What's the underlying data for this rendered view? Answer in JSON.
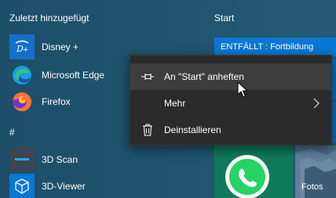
{
  "start_menu": {
    "recent_header": "Zuletzt hinzugefügt",
    "tiles_header": "Start",
    "apps": [
      {
        "label": "Disney +",
        "icon": "disney-plus-icon"
      },
      {
        "label": "Microsoft Edge",
        "icon": "edge-icon"
      },
      {
        "label": "Firefox",
        "icon": "firefox-icon"
      }
    ],
    "letter_header": "#",
    "letter_apps": [
      {
        "label": "3D Scan",
        "icon": "3d-scan-icon"
      },
      {
        "label": "3D-Viewer",
        "icon": "3d-viewer-icon"
      }
    ],
    "tiles": {
      "wide_tile_label": "ENTFÄLLT : Fortbildung",
      "whatsapp_icon": "whatsapp-icon",
      "photos_label": "Fotos"
    }
  },
  "context_menu": {
    "items": [
      {
        "label": "An \"Start\" anheften",
        "icon": "pin-icon"
      },
      {
        "label": "Mehr",
        "icon": "",
        "has_submenu": true
      },
      {
        "label": "Deinstallieren",
        "icon": "trash-icon"
      }
    ]
  },
  "colors": {
    "start_background": "#1f506d",
    "menu_background": "#2b2b2b",
    "menu_hover": "#3d3d3d",
    "tile_accent": "#0a78d4",
    "whatsapp_green": "#0f7a5a"
  }
}
